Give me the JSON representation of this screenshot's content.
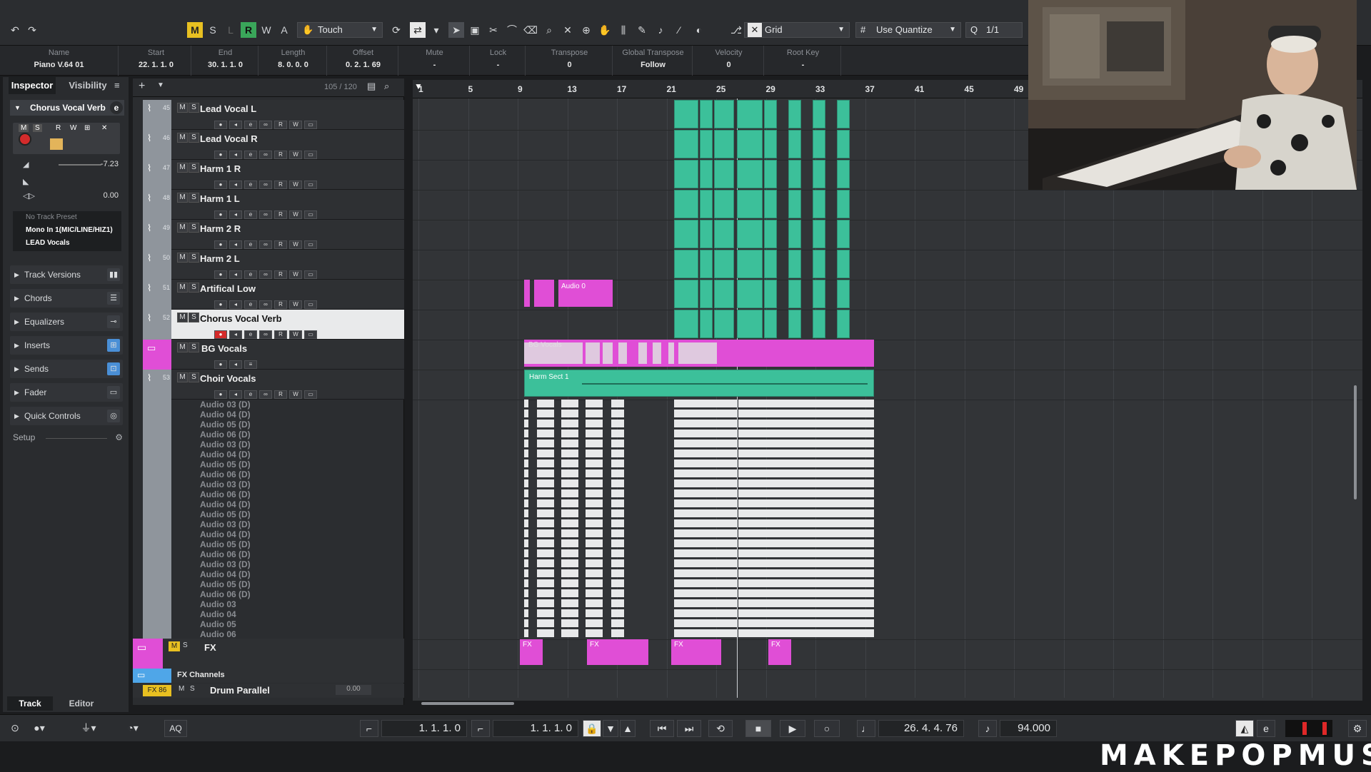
{
  "toolbar": {
    "buttons": [
      "M",
      "S",
      "L",
      "R",
      "W",
      "A"
    ],
    "automation_mode": "Touch",
    "snap_type": "Grid",
    "quantize": "Use Quantize",
    "quantize_value": "1/1"
  },
  "infoline": [
    {
      "label": "Name",
      "value": "Piano V.64 01"
    },
    {
      "label": "Start",
      "value": "22. 1. 1.   0"
    },
    {
      "label": "End",
      "value": "30. 1. 1.   0"
    },
    {
      "label": "Length",
      "value": "8. 0. 0.   0"
    },
    {
      "label": "Offset",
      "value": "0. 2. 1. 69"
    },
    {
      "label": "Mute",
      "value": "-"
    },
    {
      "label": "Lock",
      "value": "-"
    },
    {
      "label": "Transpose",
      "value": "0"
    },
    {
      "label": "Global Transpose",
      "value": "Follow"
    },
    {
      "label": "Velocity",
      "value": "0"
    },
    {
      "label": "Root Key",
      "value": "-"
    }
  ],
  "inspector": {
    "tab_inspector": "Inspector",
    "tab_visibility": "Visibility",
    "track_name": "Chorus Vocal Verb",
    "volume": "-7.23",
    "pan": "0.00",
    "preset": "No Track Preset",
    "input": "Mono In 1(MIC/LINE/HIZ1)",
    "output": "LEAD Vocals",
    "sections": [
      "Track Versions",
      "Chords",
      "Equalizers",
      "Inserts",
      "Sends",
      "Fader",
      "Quick Controls"
    ],
    "setup": "Setup",
    "bottom_tab_track": "Track",
    "bottom_tab_editor": "Editor"
  },
  "tracklist": {
    "count": "105 / 120",
    "tracks": [
      {
        "num": "45",
        "name": "Lead Vocal L"
      },
      {
        "num": "46",
        "name": "Lead Vocal R"
      },
      {
        "num": "47",
        "name": "Harm 1 R"
      },
      {
        "num": "48",
        "name": "Harm 1 L"
      },
      {
        "num": "49",
        "name": "Harm 2 R"
      },
      {
        "num": "50",
        "name": "Harm 2 L"
      },
      {
        "num": "51",
        "name": "Artifical Low"
      },
      {
        "num": "52",
        "name": "Chorus Vocal Verb"
      },
      {
        "num": "",
        "name": "BG Vocals"
      },
      {
        "num": "53",
        "name": "Choir Vocals"
      }
    ],
    "subtracks": [
      "Audio 03 (D)",
      "Audio 04 (D)",
      "Audio 05 (D)",
      "Audio 06 (D)",
      "Audio 03 (D)",
      "Audio 04 (D)",
      "Audio 05 (D)",
      "Audio 06 (D)",
      "Audio 03 (D)",
      "Audio 06 (D)",
      "Audio 04 (D)",
      "Audio 05 (D)",
      "Audio 03 (D)",
      "Audio 04 (D)",
      "Audio 05 (D)",
      "Audio 06 (D)",
      "Audio 03 (D)",
      "Audio 04 (D)",
      "Audio 05 (D)",
      "Audio 06 (D)",
      "Audio 03",
      "Audio 04",
      "Audio 05",
      "Audio 06"
    ],
    "fx_name": "FX",
    "fx_channels": "FX Channels",
    "drum_badge": "FX 86",
    "drum_name": "Drum Parallel",
    "drum_value": "0.00"
  },
  "ruler": [
    "1",
    "5",
    "9",
    "13",
    "17",
    "21",
    "25",
    "29",
    "33",
    "37",
    "41",
    "45",
    "49"
  ],
  "clip_labels": {
    "audio": "Audio 0",
    "bg": "BG Vocals",
    "harm": "Harm Sect 1",
    "fx": "FX"
  },
  "transport": {
    "left_locator": "1. 1. 1.   0",
    "right_locator": "1. 1. 1.   0",
    "position": "26. 4. 4. 76",
    "tempo": "94.000",
    "aq": "AQ"
  },
  "brand": "MAKEPOPMUSIC",
  "colors": {
    "teal": "#3cc09a",
    "pink": "#e04ed6",
    "yellow": "#e8c021"
  }
}
